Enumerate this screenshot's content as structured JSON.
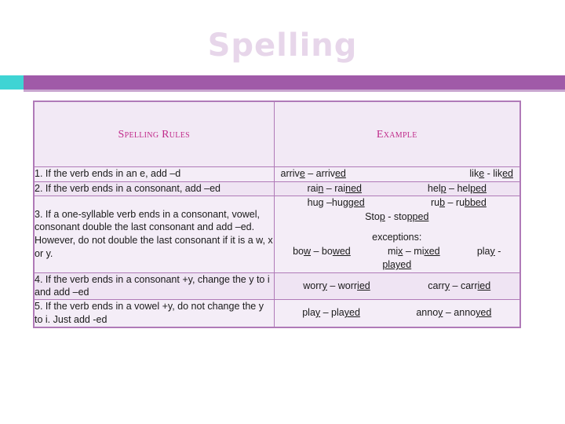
{
  "slide": {
    "title": "Spelling"
  },
  "table": {
    "headers": {
      "left": "Spelling Rules",
      "right": "Example"
    },
    "rows": [
      {
        "rule": "1.  If the verb ends in an e, add –d",
        "examples_plain": "arrive – arrived        like - liked",
        "ex1_a": "arriv",
        "ex1_b": "e",
        "ex1_c": " – arriv",
        "ex1_d": "ed",
        "ex2_a": "lik",
        "ex2_b": "e",
        "ex2_c": " - lik",
        "ex2_d": "ed"
      },
      {
        "rule": "2.  If the verb ends in a consonant, add –ed",
        "examples_plain": "rain – rained        help – helped",
        "ex1_a": "rai",
        "ex1_b": "n",
        "ex1_c": " – rai",
        "ex1_d": "ned",
        "ex2_a": "hel",
        "ex2_b": "p",
        "ex2_c": " – hel",
        "ex2_d": "ped"
      },
      {
        "rule": "3.  If a one-syllable verb ends in a consonant, vowel, consonant double the last consonant and add –ed.  However, do not double the last consonant if it is a w, x or y.",
        "examples_plain": "hug –hugged     rub – rubbed     Stop - stopped     exceptions:     bow – bowed    mix – mixed    play - played",
        "e_hug_a": "hu",
        "e_hug_b": "g",
        "e_hug_c": " –hu",
        "e_hug_d": "gged",
        "e_rub_a": "ru",
        "e_rub_b": "b",
        "e_rub_c": " – ru",
        "e_rub_d": "bbed",
        "e_stop_a": "Sto",
        "e_stop_b": "p",
        "e_stop_c": " - sto",
        "e_stop_d": "pped",
        "exceptions_label": "exceptions:",
        "e_bow_a": "bo",
        "e_bow_b": "w",
        "e_bow_c": " – bo",
        "e_bow_d": "wed",
        "e_mix_a": "mi",
        "e_mix_b": "x",
        "e_mix_c": " – mi",
        "e_mix_d": "xed",
        "e_play_a": "pla",
        "e_play_b": "y",
        "e_play_c": " - ",
        "e_play_d": "played"
      },
      {
        "rule": "4.  If the verb ends in a consonant +y, change the y to i and add –ed",
        "examples_plain": "worry – worried        carry – carried",
        "ex1_a": "worr",
        "ex1_b": "y",
        "ex1_c": " – worr",
        "ex1_d": "ied",
        "ex2_a": "carr",
        "ex2_b": "y",
        "ex2_c": " – carr",
        "ex2_d": "ied"
      },
      {
        "rule": "5.  If the verb ends in a vowel +y, do not change the y to i.  Just add -ed",
        "examples_plain": "play – played        annoy – annoyed",
        "ex1_a": "pla",
        "ex1_b": "y",
        "ex1_c": " – pla",
        "ex1_d": "yed",
        "ex2_a": "anno",
        "ex2_b": "y",
        "ex2_c": " – anno",
        "ex2_d": "yed"
      }
    ]
  },
  "colors": {
    "title": "#e7d6ea",
    "bar_main": "#a05aa8",
    "bar_accent": "#3fd4d4",
    "header_text": "#c02a8a",
    "cell_bg": "#f4edf7",
    "border": "#b07ab8"
  }
}
